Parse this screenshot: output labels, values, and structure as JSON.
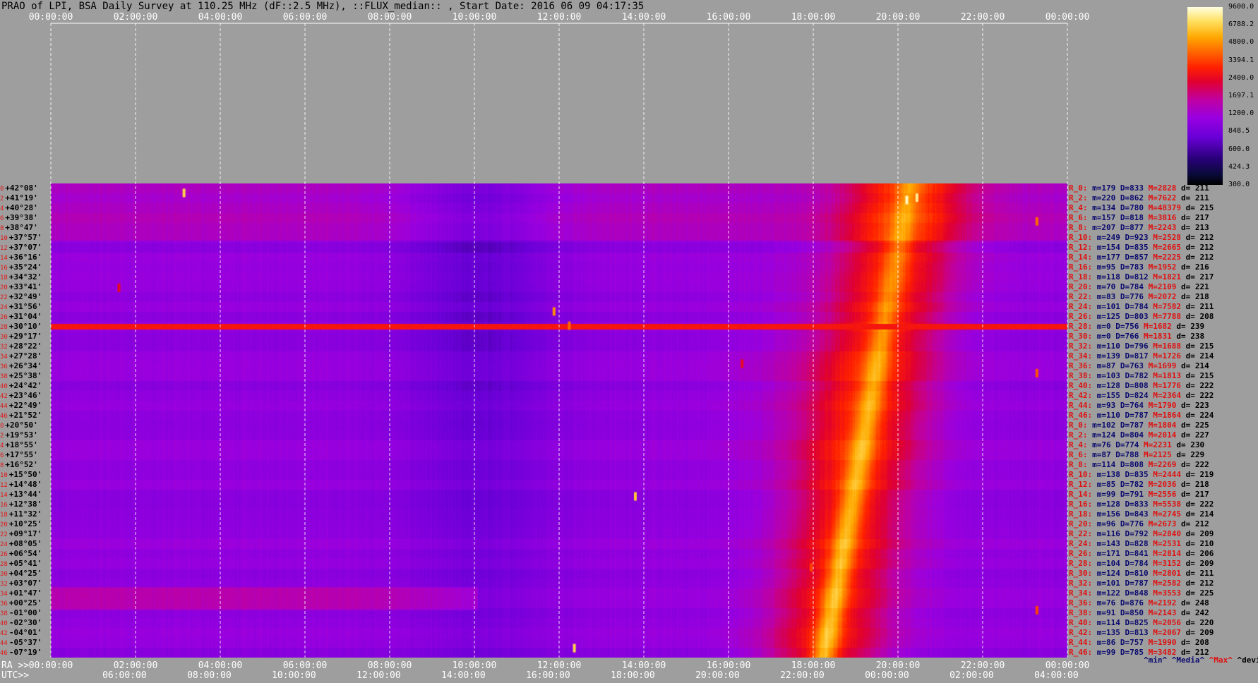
{
  "title": "PRAO of LPI, BSA Daily Survey at 110.25 MHz (dF::2.5 MHz), ::FLUX_median:: , Start Date: 2016 06 09 04:17:35",
  "chart_data": {
    "type": "heatmap",
    "title": "PRAO of LPI, BSA Daily Survey at 110.25 MHz (dF::2.5 MHz), ::FLUX_median:: , Start Date: 2016 06 09 04:17:35",
    "top_ticks": [
      "00:00:00",
      "02:00:00",
      "04:00:00",
      "06:00:00",
      "08:00:00",
      "10:00:00",
      "12:00:00",
      "14:00:00",
      "16:00:00",
      "18:00:00",
      "20:00:00",
      "22:00:00",
      "00:00:00"
    ],
    "ra_label": "RA >>",
    "ra_ticks": [
      "00:00:00",
      "02:00:00",
      "04:00:00",
      "06:00:00",
      "08:00:00",
      "10:00:00",
      "12:00:00",
      "14:00:00",
      "16:00:00",
      "18:00:00",
      "20:00:00",
      "22:00:00",
      "00:00:00"
    ],
    "utc_label": "UTC>>",
    "utc_ticks": [
      "06:00:00",
      "08:00:00",
      "10:00:00",
      "12:00:00",
      "14:00:00",
      "16:00:00",
      "18:00:00",
      "20:00:00",
      "22:00:00",
      "00:00:00",
      "02:00:00",
      "04:00:00"
    ],
    "colorbar_ticks": [
      "9600.0",
      "6788.2",
      "4800.0",
      "3394.1",
      "2400.0",
      "1697.1",
      "1200.0",
      "848.5",
      "600.0",
      "424.3",
      "300.0"
    ],
    "colorbar_range": [
      300,
      9600
    ],
    "colorbar_scale": "log",
    "declinations": [
      {
        "i": "0",
        "d": "+42°08'"
      },
      {
        "i": "2",
        "d": "+41°19'"
      },
      {
        "i": "4",
        "d": "+40°28'"
      },
      {
        "i": "6",
        "d": "+39°38'"
      },
      {
        "i": "8",
        "d": "+38°47'"
      },
      {
        "i": "10",
        "d": "+37°57'"
      },
      {
        "i": "12",
        "d": "+37°07'"
      },
      {
        "i": "14",
        "d": "+36°16'"
      },
      {
        "i": "16",
        "d": "+35°24'"
      },
      {
        "i": "18",
        "d": "+34°32'"
      },
      {
        "i": "20",
        "d": "+33°41'"
      },
      {
        "i": "22",
        "d": "+32°49'"
      },
      {
        "i": "24",
        "d": "+31°56'"
      },
      {
        "i": "26",
        "d": "+31°04'"
      },
      {
        "i": "28",
        "d": "+30°10'"
      },
      {
        "i": "30",
        "d": "+29°17'"
      },
      {
        "i": "32",
        "d": "+28°22'"
      },
      {
        "i": "34",
        "d": "+27°28'"
      },
      {
        "i": "36",
        "d": "+26°34'"
      },
      {
        "i": "38",
        "d": "+25°38'"
      },
      {
        "i": "40",
        "d": "+24°42'"
      },
      {
        "i": "42",
        "d": "+23°46'"
      },
      {
        "i": "44",
        "d": "+22°49'"
      },
      {
        "i": "46",
        "d": "+21°52'"
      },
      {
        "i": "0",
        "d": "+20°50'"
      },
      {
        "i": "2",
        "d": "+19°53'"
      },
      {
        "i": "4",
        "d": "+18°55'"
      },
      {
        "i": "6",
        "d": "+17°55'"
      },
      {
        "i": "8",
        "d": "+16°52'"
      },
      {
        "i": "10",
        "d": "+15°50'"
      },
      {
        "i": "12",
        "d": "+14°48'"
      },
      {
        "i": "14",
        "d": "+13°44'"
      },
      {
        "i": "16",
        "d": "+12°38'"
      },
      {
        "i": "18",
        "d": "+11°32'"
      },
      {
        "i": "20",
        "d": "+10°25'"
      },
      {
        "i": "22",
        "d": "+09°17'"
      },
      {
        "i": "24",
        "d": "+08°05'"
      },
      {
        "i": "26",
        "d": "+06°54'"
      },
      {
        "i": "28",
        "d": "+05°41'"
      },
      {
        "i": "30",
        "d": "+04°25'"
      },
      {
        "i": "32",
        "d": "+03°07'"
      },
      {
        "i": "34",
        "d": "+01°47'"
      },
      {
        "i": "36",
        "d": "+00°25'"
      },
      {
        "i": "38",
        "d": "-01°00'"
      },
      {
        "i": "40",
        "d": "-02°30'"
      },
      {
        "i": "42",
        "d": "-04°01'"
      },
      {
        "i": "44",
        "d": "-05°37'"
      },
      {
        "i": "46",
        "d": "-07°19'"
      }
    ],
    "row_stats": [
      {
        "r": "R_0:",
        "m": "m=179",
        "D": "D=833",
        "M": "M=2828",
        "d": "d= 211"
      },
      {
        "r": "R_2:",
        "m": "m=220",
        "D": "D=862",
        "M": "M=7622",
        "d": "d= 211"
      },
      {
        "r": "R_4:",
        "m": "m=134",
        "D": "D=780",
        "M": "M=48379",
        "d": "d= 215"
      },
      {
        "r": "R_6:",
        "m": "m=157",
        "D": "D=818",
        "M": "M=3816",
        "d": "d= 217"
      },
      {
        "r": "R_8:",
        "m": "m=207",
        "D": "D=877",
        "M": "M=2243",
        "d": "d= 213"
      },
      {
        "r": "R_10:",
        "m": "m=249",
        "D": "D=923",
        "M": "M=2528",
        "d": "d= 212"
      },
      {
        "r": "R_12:",
        "m": "m=154",
        "D": "D=835",
        "M": "M=2665",
        "d": "d= 212"
      },
      {
        "r": "R_14:",
        "m": "m=177",
        "D": "D=857",
        "M": "M=2225",
        "d": "d= 212"
      },
      {
        "r": "R_16:",
        "m": "m=95",
        "D": "D=783",
        "M": "M=1952",
        "d": "d= 216"
      },
      {
        "r": "R_18:",
        "m": "m=118",
        "D": "D=812",
        "M": "M=1821",
        "d": "d= 217"
      },
      {
        "r": "R_20:",
        "m": "m=70",
        "D": "D=784",
        "M": "M=2109",
        "d": "d= 221"
      },
      {
        "r": "R_22:",
        "m": "m=83",
        "D": "D=776",
        "M": "M=2072",
        "d": "d= 218"
      },
      {
        "r": "R_24:",
        "m": "m=101",
        "D": "D=784",
        "M": "M=7582",
        "d": "d= 211"
      },
      {
        "r": "R_26:",
        "m": "m=125",
        "D": "D=803",
        "M": "M=7788",
        "d": "d= 208"
      },
      {
        "r": "R_28:",
        "m": "m=0",
        "D": "D=756",
        "M": "M=1682",
        "d": "d= 239"
      },
      {
        "r": "R_30:",
        "m": "m=0",
        "D": "D=766",
        "M": "M=1831",
        "d": "d= 238"
      },
      {
        "r": "R_32:",
        "m": "m=110",
        "D": "D=796",
        "M": "M=1688",
        "d": "d= 215"
      },
      {
        "r": "R_34:",
        "m": "m=139",
        "D": "D=817",
        "M": "M=1726",
        "d": "d= 214"
      },
      {
        "r": "R_36:",
        "m": "m=87",
        "D": "D=763",
        "M": "M=1699",
        "d": "d= 214"
      },
      {
        "r": "R_38:",
        "m": "m=103",
        "D": "D=782",
        "M": "M=1813",
        "d": "d= 215"
      },
      {
        "r": "R_40:",
        "m": "m=128",
        "D": "D=808",
        "M": "M=1776",
        "d": "d= 222"
      },
      {
        "r": "R_42:",
        "m": "m=155",
        "D": "D=824",
        "M": "M=2364",
        "d": "d= 222"
      },
      {
        "r": "R_44:",
        "m": "m=93",
        "D": "D=764",
        "M": "M=1790",
        "d": "d= 223"
      },
      {
        "r": "R_46:",
        "m": "m=110",
        "D": "D=787",
        "M": "M=1864",
        "d": "d= 224"
      },
      {
        "r": "R_0:",
        "m": "m=102",
        "D": "D=787",
        "M": "M=1804",
        "d": "d= 225"
      },
      {
        "r": "R_2:",
        "m": "m=124",
        "D": "D=804",
        "M": "M=2014",
        "d": "d= 227"
      },
      {
        "r": "R_4:",
        "m": "m=76",
        "D": "D=774",
        "M": "M=2231",
        "d": "d= 230"
      },
      {
        "r": "R_6:",
        "m": "m=87",
        "D": "D=788",
        "M": "M=2125",
        "d": "d= 229"
      },
      {
        "r": "R_8:",
        "m": "m=114",
        "D": "D=808",
        "M": "M=2269",
        "d": "d= 222"
      },
      {
        "r": "R_10:",
        "m": "m=138",
        "D": "D=835",
        "M": "M=2444",
        "d": "d= 219"
      },
      {
        "r": "R_12:",
        "m": "m=85",
        "D": "D=782",
        "M": "M=2036",
        "d": "d= 218"
      },
      {
        "r": "R_14:",
        "m": "m=99",
        "D": "D=791",
        "M": "M=2556",
        "d": "d= 217"
      },
      {
        "r": "R_16:",
        "m": "m=128",
        "D": "D=833",
        "M": "M=5538",
        "d": "d= 222"
      },
      {
        "r": "R_18:",
        "m": "m=156",
        "D": "D=843",
        "M": "M=2745",
        "d": "d= 214"
      },
      {
        "r": "R_20:",
        "m": "m=96",
        "D": "D=776",
        "M": "M=2673",
        "d": "d= 212"
      },
      {
        "r": "R_22:",
        "m": "m=116",
        "D": "D=792",
        "M": "M=2840",
        "d": "d= 209"
      },
      {
        "r": "R_24:",
        "m": "m=143",
        "D": "D=828",
        "M": "M=2531",
        "d": "d= 210"
      },
      {
        "r": "R_26:",
        "m": "m=171",
        "D": "D=841",
        "M": "M=2814",
        "d": "d= 206"
      },
      {
        "r": "R_28:",
        "m": "m=104",
        "D": "D=784",
        "M": "M=3152",
        "d": "d= 209"
      },
      {
        "r": "R_30:",
        "m": "m=124",
        "D": "D=810",
        "M": "M=2801",
        "d": "d= 211"
      },
      {
        "r": "R_32:",
        "m": "m=101",
        "D": "D=787",
        "M": "M=2582",
        "d": "d= 212"
      },
      {
        "r": "R_34:",
        "m": "m=122",
        "D": "D=848",
        "M": "M=3553",
        "d": "d= 225"
      },
      {
        "r": "R_36:",
        "m": "m=76",
        "D": "D=876",
        "M": "M=2192",
        "d": "d= 248"
      },
      {
        "r": "R_38:",
        "m": "m=91",
        "D": "D=850",
        "M": "M=2143",
        "d": "d= 242"
      },
      {
        "r": "R_40:",
        "m": "m=114",
        "D": "D=825",
        "M": "M=2056",
        "d": "d= 220"
      },
      {
        "r": "R_42:",
        "m": "m=135",
        "D": "D=813",
        "M": "M=2067",
        "d": "d= 209"
      },
      {
        "r": "R_44:",
        "m": "m=86",
        "D": "D=757",
        "M": "M=1990",
        "d": "d= 208"
      },
      {
        "r": "R_46:",
        "m": "m=99",
        "D": "D=785",
        "M": "M=3482",
        "d": "d= 212"
      }
    ],
    "stats_legend": {
      "min": "^min^",
      "median": "^Media^",
      "max": "^Max^",
      "devia": "^devia^"
    },
    "colors": {
      "background": "#9e9e9e",
      "blank_region": "#000000",
      "label_red": "#e01010",
      "label_navy": "#0a0a6e"
    }
  }
}
